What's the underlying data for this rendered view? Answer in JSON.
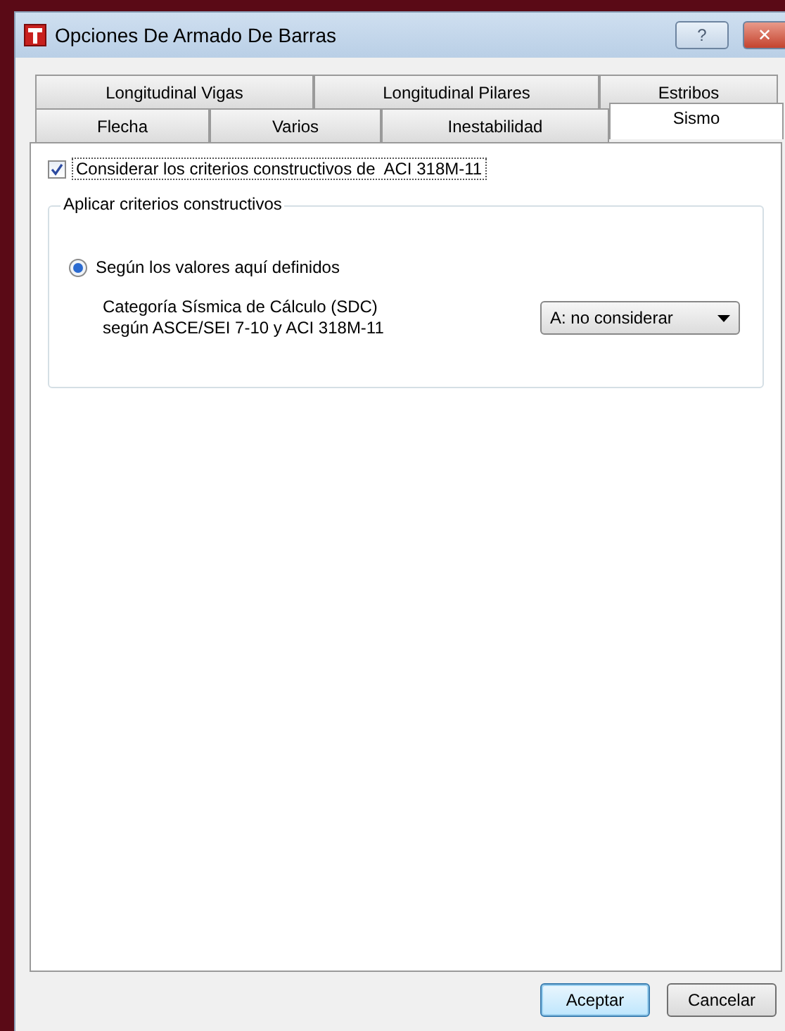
{
  "window": {
    "title": "Opciones De Armado De Barras",
    "buttons": [
      "?",
      "✕"
    ]
  },
  "tab_rows": [
    [
      {
        "label": "Longitudinal Vigas",
        "selected": false
      },
      {
        "label": "Longitudinal Pilares",
        "selected": false
      },
      {
        "label": "Estribos",
        "selected": false
      }
    ],
    [
      {
        "label": "Flecha",
        "selected": false
      },
      {
        "label": "Varios",
        "selected": false
      },
      {
        "label": "Inestabilidad",
        "selected": false
      },
      {
        "label": "Sismo",
        "selected": true
      }
    ]
  ],
  "apply_checkbox": {
    "label": "Considerar los criterios constructivos de  ACI 318M-11",
    "checked": true
  },
  "group": {
    "title": "Aplicar criterios constructivos",
    "radio": {
      "label": "Según los valores aquí definidos",
      "selected": true
    },
    "field_label": [
      "Categoría Sísmica de Cálculo (SDC)",
      "según ASCE/SEI 7-10 y ACI 318M-11"
    ],
    "dropdown": {
      "value": "A: no considerar"
    }
  },
  "buttons": [
    {
      "label": "Aceptar",
      "default": true
    },
    {
      "label": "Cancelar",
      "default": false
    }
  ]
}
